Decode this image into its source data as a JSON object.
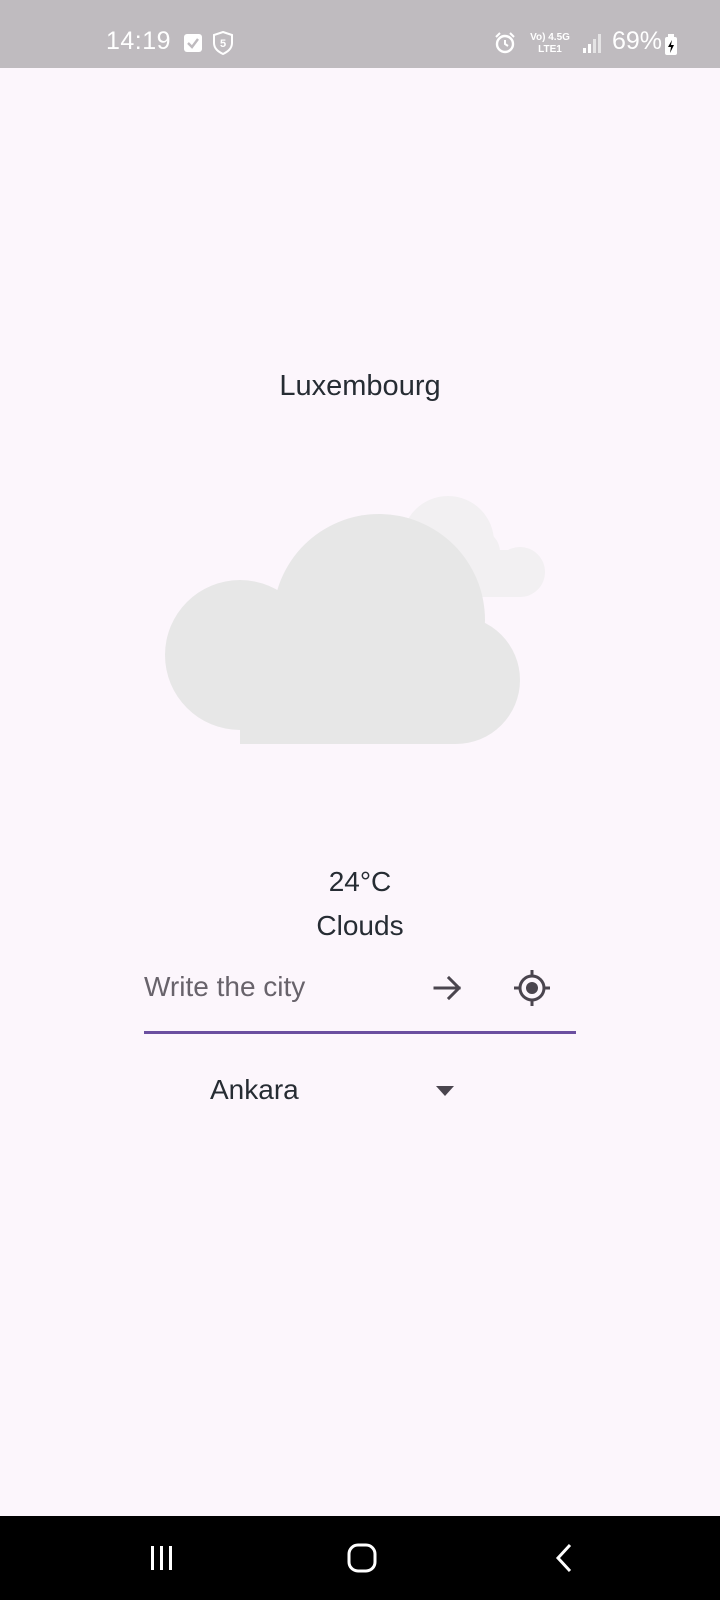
{
  "status_bar": {
    "time": "14:19",
    "battery_percent": "69%",
    "network_top": "Vo) 4.5G",
    "network_bottom": "LTE1",
    "icons": [
      "checkbox-icon",
      "shield-5-icon",
      "alarm-icon",
      "signal-icon",
      "battery-icon"
    ]
  },
  "weather": {
    "city": "Luxembourg",
    "temperature": "24°C",
    "condition": "Clouds",
    "icon": "cloud-icon"
  },
  "search": {
    "placeholder": "Write the city",
    "value": ""
  },
  "dropdown": {
    "selected": "Ankara"
  },
  "colors": {
    "background": "#fcf6fc",
    "status_bar": "#bfbbbf",
    "text": "#262c33",
    "accent": "#6b4fa0",
    "cloud_front": "#e7e7e7",
    "cloud_back": "#f2f0f2"
  }
}
